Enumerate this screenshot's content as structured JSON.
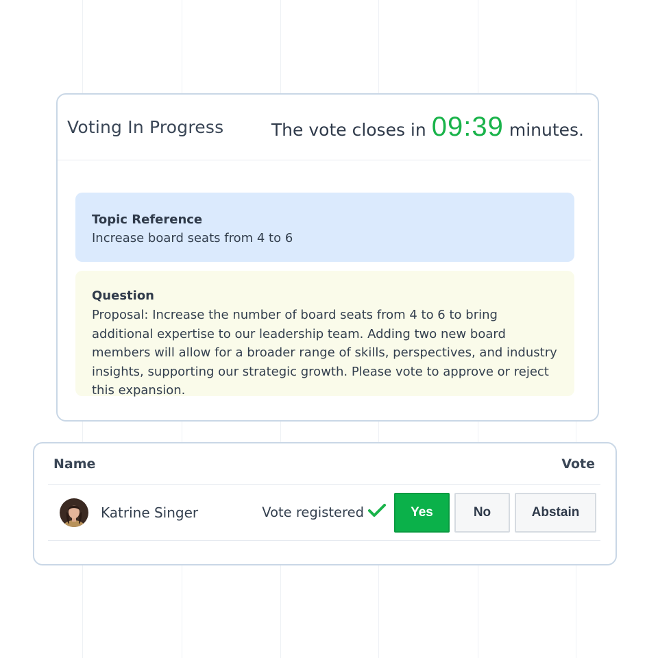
{
  "voting": {
    "title": "Voting In Progress",
    "countdown_prefix": "The vote closes in",
    "countdown_time": "09:39",
    "countdown_suffix": "minutes.",
    "topic": {
      "label": "Topic Reference",
      "text": "Increase board seats from 4 to 6"
    },
    "question": {
      "label": "Question",
      "text": "Proposal: Increase the number of board seats from 4 to 6 to bring additional expertise to our leadership team. Adding two new board members will allow for a broader range of skills, perspectives, and industry insights, supporting our strategic growth. Please vote to approve or reject this expansion."
    }
  },
  "votes_table": {
    "columns": [
      "Name",
      "Vote"
    ],
    "rows": [
      {
        "name": "Katrine Singer",
        "status": "Vote registered",
        "status_icon": "checkmark-icon",
        "options": [
          "Yes",
          "No",
          "Abstain"
        ],
        "selected": "Yes"
      }
    ]
  },
  "colors": {
    "accent_green": "#19b34a",
    "topic_bg": "#dbeafd",
    "question_bg": "#fafbea",
    "border": "#c9d7e6"
  }
}
